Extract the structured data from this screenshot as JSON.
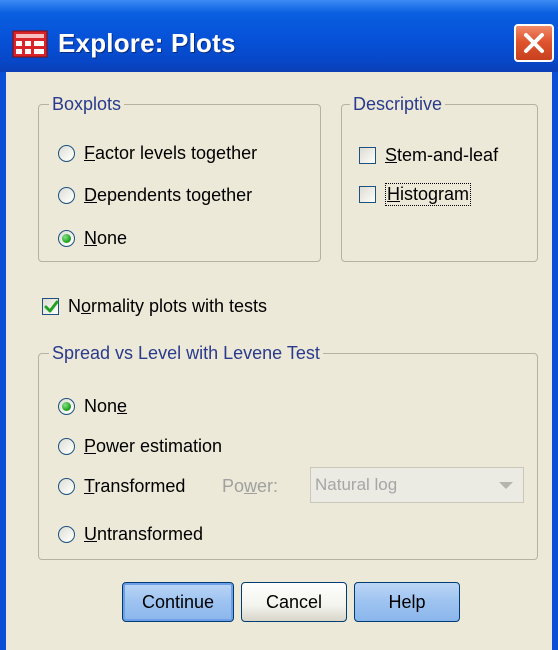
{
  "window": {
    "title": "Explore: Plots",
    "icons": {
      "app": "spss-grid-icon",
      "close": "close-icon"
    }
  },
  "boxplots": {
    "legend": "Boxplots",
    "options": [
      {
        "label": "Factor levels together",
        "selected": false,
        "mnemonic": "F"
      },
      {
        "label": "Dependents together",
        "selected": false,
        "mnemonic": "D"
      },
      {
        "label": "None",
        "selected": true,
        "mnemonic": "N"
      }
    ]
  },
  "descriptive": {
    "legend": "Descriptive",
    "options": [
      {
        "label": "Stem-and-leaf",
        "checked": false,
        "mnemonic": "S"
      },
      {
        "label": "Histogram",
        "checked": false,
        "mnemonic": "H",
        "focused": true
      }
    ]
  },
  "normality": {
    "label": "Normality plots with tests",
    "checked": true,
    "mnemonic": "o"
  },
  "spread": {
    "legend": "Spread vs Level with Levene Test",
    "options": [
      {
        "label": "None",
        "selected": true,
        "mnemonic": "e"
      },
      {
        "label": "Power estimation",
        "selected": false,
        "mnemonic": "P"
      },
      {
        "label": "Transformed",
        "selected": false,
        "mnemonic": "T"
      },
      {
        "label": "Untransformed",
        "selected": false,
        "mnemonic": "U"
      }
    ],
    "power_label": "Power:",
    "power_value": "Natural log"
  },
  "buttons": {
    "continue": "Continue",
    "cancel": "Cancel",
    "help": "Help"
  },
  "colors": {
    "title_bar": "#0651d8",
    "client": "#ece9d8",
    "legend_text": "#2a3a8c",
    "close_button": "#e0552f",
    "radio_dot": "#22a822"
  }
}
